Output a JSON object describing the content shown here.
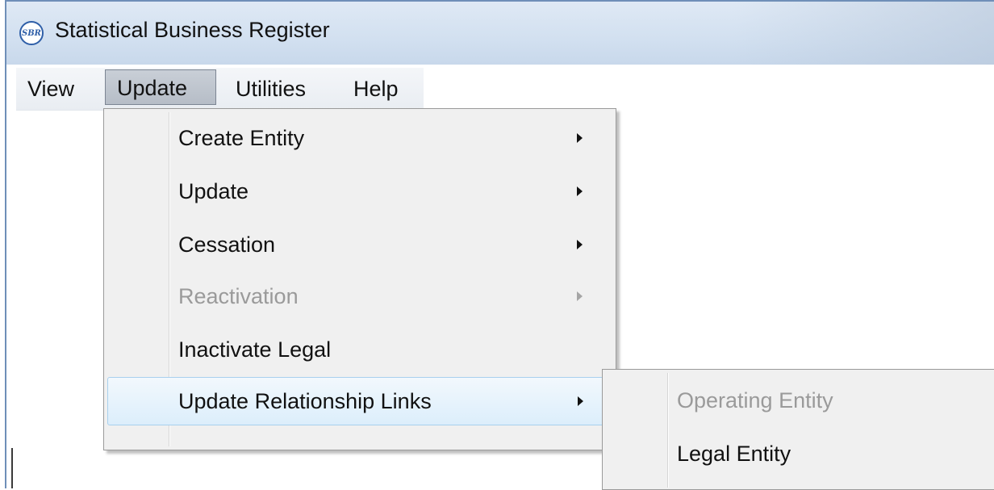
{
  "window": {
    "title": "Statistical Business Register",
    "icon": "sbr-logo-icon"
  },
  "menubar": {
    "items": [
      "View",
      "Update",
      "Utilities",
      "Help"
    ],
    "active": "Update"
  },
  "update_menu": {
    "items": [
      {
        "label": "Create Entity",
        "submenu": true,
        "enabled": true
      },
      {
        "label": "Update",
        "submenu": true,
        "enabled": true
      },
      {
        "label": "Cessation",
        "submenu": true,
        "enabled": true
      },
      {
        "label": "Reactivation",
        "submenu": true,
        "enabled": false
      },
      {
        "label": "Inactivate Legal",
        "submenu": false,
        "enabled": true
      },
      {
        "label": "Update Relationship Links",
        "submenu": true,
        "enabled": true,
        "highlighted": true
      }
    ]
  },
  "relationship_submenu": {
    "items": [
      {
        "label": "Operating Entity",
        "enabled": false
      },
      {
        "label": "Legal Entity",
        "enabled": true
      }
    ]
  }
}
